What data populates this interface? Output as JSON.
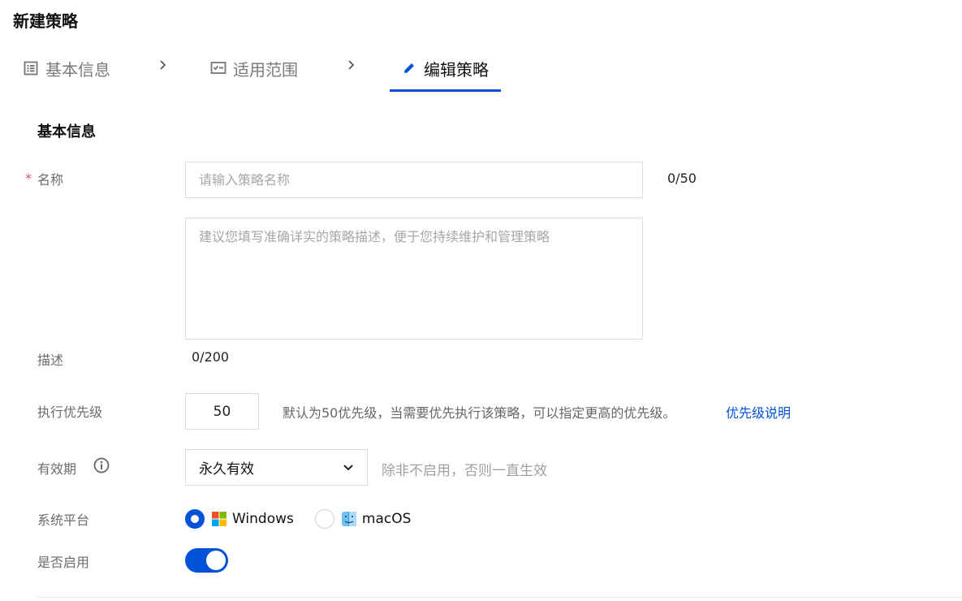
{
  "page": {
    "title": "新建策略"
  },
  "steps": [
    {
      "label": "基本信息",
      "icon": "list-icon",
      "state": "done"
    },
    {
      "label": "适用范围",
      "icon": "checklist-icon",
      "state": "done"
    },
    {
      "label": "编辑策略",
      "icon": "pencil-icon",
      "state": "active"
    }
  ],
  "section": {
    "title": "基本信息"
  },
  "form": {
    "name": {
      "required_mark": "*",
      "label": "名称",
      "placeholder": "请输入策略名称",
      "value": "",
      "counter": "0/50"
    },
    "description": {
      "label": "描述",
      "placeholder": "建议您填写准确详实的策略描述，便于您持续维护和管理策略",
      "value": "",
      "counter": "0/200"
    },
    "priority": {
      "label": "执行优先级",
      "value": "50",
      "hint": "默认为50优先级，当需要优先执行该策略，可以指定更高的优先级。",
      "link": "优先级说明"
    },
    "validity": {
      "label": "有效期",
      "selected": "永久有效",
      "hint": "除非不启用，否则一直生效"
    },
    "platform": {
      "label": "系统平台",
      "options": [
        {
          "label": "Windows",
          "checked": true
        },
        {
          "label": "macOS",
          "checked": false
        }
      ]
    },
    "enabled": {
      "label": "是否启用",
      "value": true
    }
  },
  "colors": {
    "primary": "#0052d9",
    "required": "#e34d59"
  }
}
